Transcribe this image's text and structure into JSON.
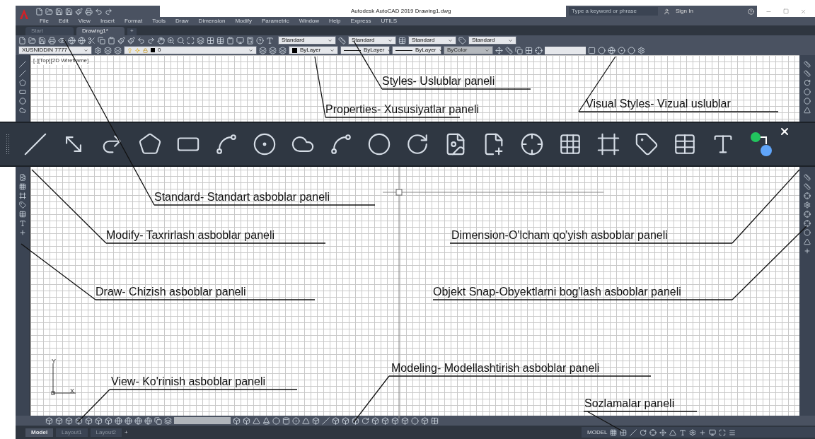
{
  "window": {
    "title": "Autodesk AutoCAD 2019  Drawing1.dwg",
    "search_placeholder": "Type a keyword or phrase",
    "sign_in": "Sign In"
  },
  "menu": [
    "File",
    "Edit",
    "View",
    "Insert",
    "Format",
    "Tools",
    "Draw",
    "Dimension",
    "Modify",
    "Parametric",
    "Window",
    "Help",
    "Express",
    "UTILS"
  ],
  "file_tabs": [
    {
      "label": "Start",
      "selected": false
    },
    {
      "label": "Drawing1*",
      "selected": true
    }
  ],
  "new_tab": "+",
  "styles_toolbar": [
    "Standard",
    "Standard",
    "Standard",
    "Standard"
  ],
  "layers_toolbar": {
    "layer_state": "XUSNIDDIN 7777",
    "current_layer": "0"
  },
  "properties_toolbar": [
    {
      "value": "ByLayer",
      "kind": "color",
      "disabled": false
    },
    {
      "value": "ByLayer",
      "kind": "linetype",
      "disabled": false
    },
    {
      "value": "ByLayer",
      "kind": "lineweight",
      "disabled": false
    },
    {
      "value": "ByColor",
      "kind": "plotstyle",
      "disabled": true
    }
  ],
  "viewport_label": "[-][Top][2D Wireframe]",
  "ucs": {
    "x": "X",
    "y": "Y"
  },
  "layout_tabs": [
    {
      "label": "Model",
      "selected": true
    },
    {
      "label": "Layout1",
      "selected": false
    },
    {
      "label": "Layout2",
      "selected": false
    }
  ],
  "add_layout": "+",
  "status_bar": {
    "space": "MODEL"
  },
  "annotations": [
    {
      "text": "Styles- Uslublar paneli"
    },
    {
      "text": "Properties- Xususiyatlar paneli"
    },
    {
      "text": "Visual Styles- Vizual uslublar"
    },
    {
      "text": "Standard- Standart asboblar paneli"
    },
    {
      "text": "Modify- Taxrirlash asboblar paneli"
    },
    {
      "text": "Dimension-O'lcham qo'yish asboblar paneli"
    },
    {
      "text": "Draw- Chizish asboblar paneli"
    },
    {
      "text": "Objekt Snap-Obyektlarni bog'lash asboblar paneli"
    },
    {
      "text": "Modeling- Modellashtirish asboblar paneli"
    },
    {
      "text": "View- Ko'rinish asboblar paneli"
    },
    {
      "text": "Sozlamalar paneli"
    }
  ]
}
